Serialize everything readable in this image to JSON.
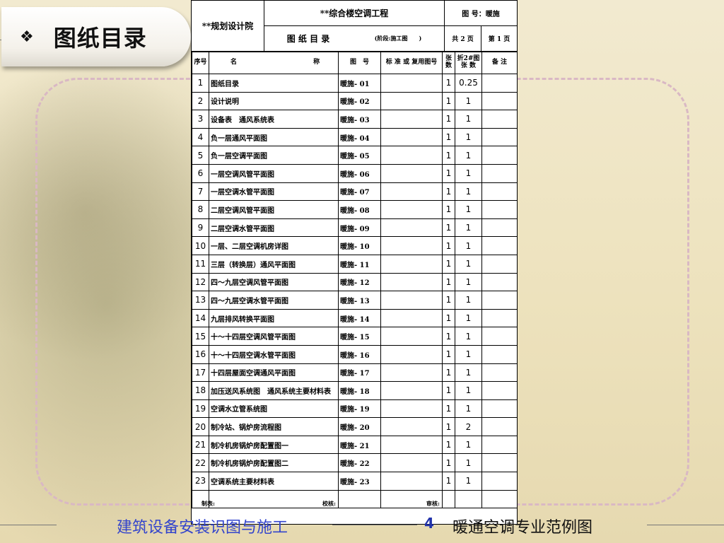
{
  "slide": {
    "bullet": "❖",
    "title": "图纸目录"
  },
  "sheet": {
    "institute": "**规划设计院",
    "project": "**综合楼空调工程",
    "doc_title": "图 纸 目 录",
    "stage": "(阶段:施工图　　)",
    "drawing_no_label": "图 号：暖施",
    "total_pages": "共 2 页",
    "page_no": "第 1 页",
    "columns": {
      "seq": "序号",
      "name_a": "名",
      "name_b": "称",
      "code": "图　号",
      "standard": "标 准 或 复用图号",
      "sheets": "张数",
      "converted": "折2#图 张 数",
      "remarks": "备 注"
    },
    "rows": [
      {
        "no": "1",
        "name": "图纸目录",
        "code": "暖施- 01",
        "sheets": "1",
        "conv": "0.25"
      },
      {
        "no": "2",
        "name": "设计说明",
        "code": "暖施- 02",
        "sheets": "1",
        "conv": "1"
      },
      {
        "no": "3",
        "name": "设备表　通风系统表",
        "code": "暖施- 03",
        "sheets": "1",
        "conv": "1"
      },
      {
        "no": "4",
        "name": "负一层通风平面图",
        "code": "暖施- 04",
        "sheets": "1",
        "conv": "1"
      },
      {
        "no": "5",
        "name": "负一层空调平面图",
        "code": "暖施- 05",
        "sheets": "1",
        "conv": "1"
      },
      {
        "no": "6",
        "name": "一层空调风管平面图",
        "code": "暖施- 06",
        "sheets": "1",
        "conv": "1"
      },
      {
        "no": "7",
        "name": "一层空调水管平面图",
        "code": "暖施- 07",
        "sheets": "1",
        "conv": "1"
      },
      {
        "no": "8",
        "name": "二层空调风管平面图",
        "code": "暖施- 08",
        "sheets": "1",
        "conv": "1"
      },
      {
        "no": "9",
        "name": "二层空调水管平面图",
        "code": "暖施- 09",
        "sheets": "1",
        "conv": "1"
      },
      {
        "no": "10",
        "name": "一层、二层空调机房详图",
        "code": "暖施- 10",
        "sheets": "1",
        "conv": "1"
      },
      {
        "no": "11",
        "name": "三层（转换层）通风平面图",
        "code": "暖施- 11",
        "sheets": "1",
        "conv": "1"
      },
      {
        "no": "12",
        "name": "四～九层空调风管平面图",
        "code": "暖施- 12",
        "sheets": "1",
        "conv": "1"
      },
      {
        "no": "13",
        "name": "四～九层空调水管平面图",
        "code": "暖施- 13",
        "sheets": "1",
        "conv": "1"
      },
      {
        "no": "14",
        "name": "九层排风转换平面图",
        "code": "暖施- 14",
        "sheets": "1",
        "conv": "1"
      },
      {
        "no": "15",
        "name": "十～十四层空调风管平面图",
        "code": "暖施- 15",
        "sheets": "1",
        "conv": "1"
      },
      {
        "no": "16",
        "name": "十～十四层空调水管平面图",
        "code": "暖施- 16",
        "sheets": "1",
        "conv": "1"
      },
      {
        "no": "17",
        "name": "十四层屋面空调通风平面图",
        "code": "暖施- 17",
        "sheets": "1",
        "conv": "1"
      },
      {
        "no": "18",
        "name": "加压送风系统图　通风系统主要材料表",
        "code": "暖施- 18",
        "sheets": "1",
        "conv": "1"
      },
      {
        "no": "19",
        "name": "空调水立管系统图",
        "code": "暖施- 19",
        "sheets": "1",
        "conv": "1"
      },
      {
        "no": "20",
        "name": "制冷站、锅炉房流程图",
        "code": "暖施- 20",
        "sheets": "1",
        "conv": "2"
      },
      {
        "no": "21",
        "name": "制冷机房锅炉房配置图一",
        "code": "暖施- 21",
        "sheets": "1",
        "conv": "1"
      },
      {
        "no": "22",
        "name": "制冷机房锅炉房配置图二",
        "code": "暖施- 22",
        "sheets": "1",
        "conv": "1"
      },
      {
        "no": "23",
        "name": "空调系统主要材料表",
        "code": "暖施- 23",
        "sheets": "1",
        "conv": "1"
      }
    ],
    "blank_rows": 1,
    "signatures": {
      "drawn": "制表:",
      "checked": "校核:",
      "approved": "审核:"
    }
  },
  "footer": {
    "course": "建筑设备安装识图与施工",
    "page": "4",
    "topic": "暖通空调专业范例图"
  }
}
